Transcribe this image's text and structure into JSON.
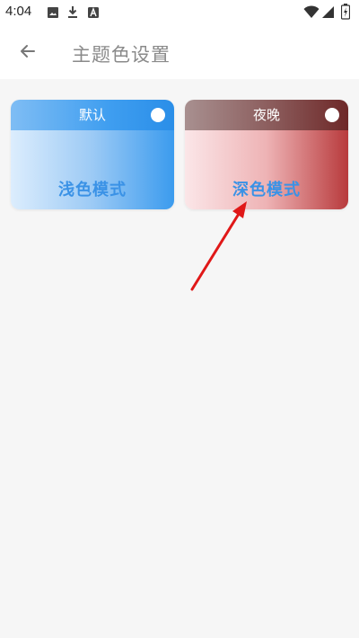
{
  "status_bar": {
    "time": "4:04",
    "icons": [
      "image-icon",
      "download-icon",
      "accessibility-icon",
      "wifi-icon",
      "signal-icon",
      "battery-icon"
    ]
  },
  "app_bar": {
    "back_icon": "arrow-left-icon",
    "title": "主题色设置"
  },
  "themes": [
    {
      "name": "默认",
      "mode_label": "浅色模式",
      "header_color": "#3f9ef0",
      "selected": false
    },
    {
      "name": "夜晚",
      "mode_label": "深色模式",
      "header_color": "#8a5a5a",
      "selected": false
    }
  ],
  "colors": {
    "accent_text": "#3a92e6",
    "annotation_arrow": "#e01818",
    "background": "#f6f6f6"
  }
}
